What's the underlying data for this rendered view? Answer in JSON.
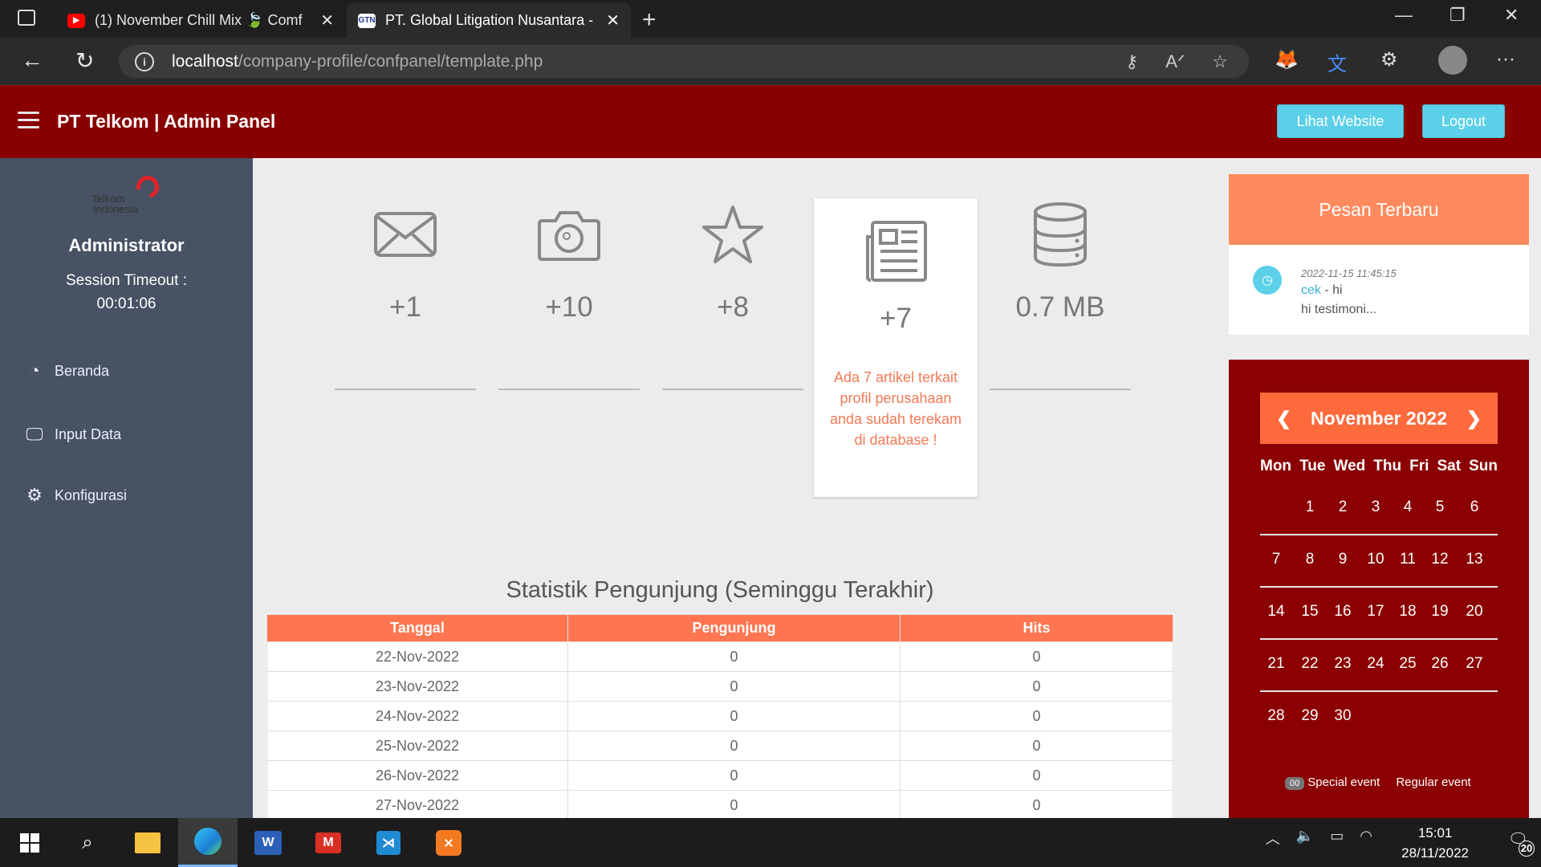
{
  "browser": {
    "tabs": [
      {
        "title": "(1) November Chill Mix 🍃 Comf",
        "favicon": "youtube-icon"
      },
      {
        "title": "PT. Global Litigation Nusantara -",
        "favicon": "gtn-icon"
      }
    ],
    "url_host": "localhost",
    "url_path": "/company-profile/confpanel/template.php"
  },
  "header": {
    "brand": "PT Telkom | Admin Panel",
    "view_site_label": "Lihat Website",
    "logout_label": "Logout",
    "color": "#890000"
  },
  "sidebar": {
    "logo_text_1": "Telkom",
    "logo_text_2": "Indonesia",
    "user": "Administrator",
    "session_label": "Session Timeout :",
    "session_value": "00:01:06",
    "items": [
      {
        "label": "Beranda",
        "icon": "dashboard-icon"
      },
      {
        "label": "Input Data",
        "icon": "monitor-icon"
      },
      {
        "label": "Konfigurasi",
        "icon": "gears-icon"
      }
    ]
  },
  "stats": [
    {
      "icon": "envelope-icon",
      "value": "+1"
    },
    {
      "icon": "camera-icon",
      "value": "+10"
    },
    {
      "icon": "star-icon",
      "value": "+8"
    },
    {
      "icon": "newspaper-icon",
      "value": "+7",
      "message": "Ada 7 artikel terkait profil perusahaan anda sudah terekam di database !"
    },
    {
      "icon": "database-icon",
      "value": "0.7 MB"
    }
  ],
  "visitor_table": {
    "title": "Statistik Pengunjung (Seminggu Terakhir)",
    "headers": [
      "Tanggal",
      "Pengunjung",
      "Hits"
    ],
    "rows": [
      [
        "22-Nov-2022",
        "0",
        "0"
      ],
      [
        "23-Nov-2022",
        "0",
        "0"
      ],
      [
        "24-Nov-2022",
        "0",
        "0"
      ],
      [
        "25-Nov-2022",
        "0",
        "0"
      ],
      [
        "26-Nov-2022",
        "0",
        "0"
      ],
      [
        "27-Nov-2022",
        "0",
        "0"
      ]
    ]
  },
  "messages": {
    "title": "Pesan Terbaru",
    "items": [
      {
        "date": "2022-11-15 11:45:15",
        "name": "cek",
        "subject": " - hi",
        "body": "hi testimoni..."
      }
    ]
  },
  "calendar": {
    "month": "November 2022",
    "days": [
      "Mon",
      "Tue",
      "Wed",
      "Thu",
      "Fri",
      "Sat",
      "Sun"
    ],
    "weeks": [
      [
        "",
        "1",
        "2",
        "3",
        "4",
        "5",
        "6"
      ],
      [
        "7",
        "8",
        "9",
        "10",
        "11",
        "12",
        "13"
      ],
      [
        "14",
        "15",
        "16",
        "17",
        "18",
        "19",
        "20"
      ],
      [
        "21",
        "22",
        "23",
        "24",
        "25",
        "26",
        "27"
      ],
      [
        "28",
        "29",
        "30",
        "",
        "",
        "",
        ""
      ]
    ],
    "legend_badge": "00",
    "legend_special": "Special event",
    "legend_regular": "Regular event"
  },
  "taskbar": {
    "time": "15:01",
    "date": "28/11/2022",
    "notifications": "20"
  }
}
